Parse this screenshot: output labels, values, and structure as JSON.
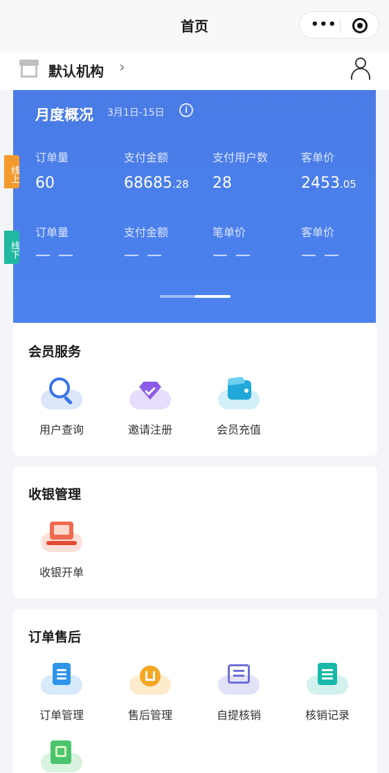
{
  "navbar": {
    "title": "首页",
    "more_icon": "more-dots-icon",
    "close_icon": "target-icon"
  },
  "org": {
    "name": "默认机构",
    "chevron": "›",
    "store_icon": "store-icon",
    "user_icon": "user-icon"
  },
  "overview": {
    "title": "月度概况",
    "range": "3月1日-15日",
    "info": "i",
    "online": [
      {
        "label": "订单量",
        "value": "60",
        "decimal": ""
      },
      {
        "label": "支付金额",
        "value": "68685",
        "decimal": ".28"
      },
      {
        "label": "支付用户数",
        "value": "28",
        "decimal": ""
      },
      {
        "label": "客单价",
        "value": "2453",
        "decimal": ".05"
      }
    ],
    "offline": [
      {
        "label": "订单量",
        "value": "— —"
      },
      {
        "label": "支付金额",
        "value": "— —"
      },
      {
        "label": "笔单价",
        "value": "— —"
      },
      {
        "label": "客单价",
        "value": "— —"
      }
    ],
    "pager": {
      "pages": 2,
      "active": 2
    }
  },
  "side_tabs": {
    "online": "线上",
    "offline": "线下"
  },
  "sections": {
    "member": {
      "title": "会员服务",
      "items": [
        {
          "label": "用户查询",
          "icon": "search-icon",
          "color": "#3a72e8"
        },
        {
          "label": "邀请注册",
          "icon": "diamond-icon",
          "color": "#8c5ce8"
        },
        {
          "label": "会员充值",
          "icon": "wallet-icon",
          "color": "#22a8d8"
        }
      ]
    },
    "cashier": {
      "title": "收银管理",
      "items": [
        {
          "label": "收银开单",
          "icon": "cashier-icon",
          "color": "#f06a50"
        }
      ]
    },
    "orders": {
      "title": "订单售后",
      "items": [
        {
          "label": "订单管理",
          "icon": "order-doc-icon",
          "color": "#2f95ea"
        },
        {
          "label": "售后管理",
          "icon": "after-sale-icon",
          "color": "#f5a623"
        },
        {
          "label": "自提核销",
          "icon": "scan-icon",
          "color": "#6c6fd8"
        },
        {
          "label": "核销记录",
          "icon": "record-icon",
          "color": "#18b8a8"
        },
        {
          "label": "",
          "icon": "ticket-icon",
          "color": "#4cc46e"
        }
      ]
    }
  }
}
